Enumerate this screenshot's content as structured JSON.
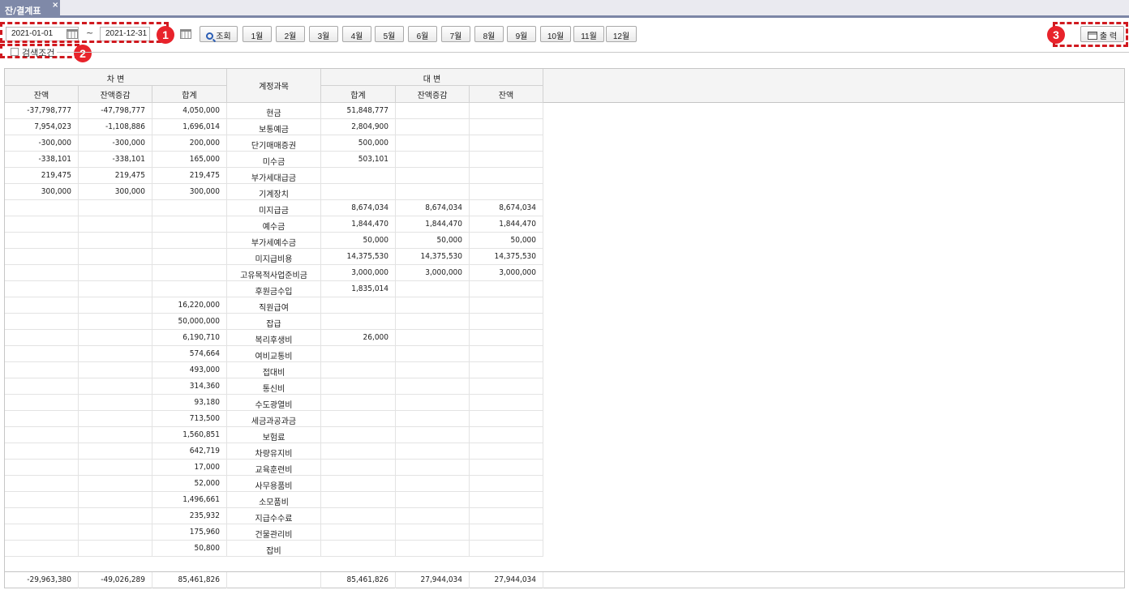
{
  "tab": {
    "title": "잔/결계표",
    "close": "×"
  },
  "toolbar": {
    "date_from": "2021-01-01",
    "tilde": "~",
    "date_to": "2021-12-31",
    "search_label": "조회",
    "months": [
      "1월",
      "2월",
      "3월",
      "4월",
      "5월",
      "6월",
      "7월",
      "8월",
      "9월",
      "10월",
      "11월",
      "12월"
    ],
    "print_label": "출 력"
  },
  "callouts": [
    "1",
    "2",
    "3"
  ],
  "search_conditions": {
    "label": "검색조건"
  },
  "header": {
    "debit_group": "차 변",
    "credit_group": "대 변",
    "account": "계정과목",
    "debit_cols": [
      "잔액",
      "잔액증감",
      "합계"
    ],
    "credit_cols": [
      "합계",
      "잔액증감",
      "잔액"
    ]
  },
  "rows": [
    {
      "d_bal": "-37,798,777",
      "d_chg": "-47,798,777",
      "d_sum": "4,050,000",
      "account": "현금",
      "c_sum": "51,848,777",
      "c_chg": "",
      "c_bal": ""
    },
    {
      "d_bal": "7,954,023",
      "d_chg": "-1,108,886",
      "d_sum": "1,696,014",
      "account": "보통예금",
      "c_sum": "2,804,900",
      "c_chg": "",
      "c_bal": ""
    },
    {
      "d_bal": "-300,000",
      "d_chg": "-300,000",
      "d_sum": "200,000",
      "account": "단기매매증권",
      "c_sum": "500,000",
      "c_chg": "",
      "c_bal": ""
    },
    {
      "d_bal": "-338,101",
      "d_chg": "-338,101",
      "d_sum": "165,000",
      "account": "미수금",
      "c_sum": "503,101",
      "c_chg": "",
      "c_bal": ""
    },
    {
      "d_bal": "219,475",
      "d_chg": "219,475",
      "d_sum": "219,475",
      "account": "부가세대급금",
      "c_sum": "",
      "c_chg": "",
      "c_bal": ""
    },
    {
      "d_bal": "300,000",
      "d_chg": "300,000",
      "d_sum": "300,000",
      "account": "기계장치",
      "c_sum": "",
      "c_chg": "",
      "c_bal": ""
    },
    {
      "d_bal": "",
      "d_chg": "",
      "d_sum": "",
      "account": "미지급금",
      "c_sum": "8,674,034",
      "c_chg": "8,674,034",
      "c_bal": "8,674,034"
    },
    {
      "d_bal": "",
      "d_chg": "",
      "d_sum": "",
      "account": "예수금",
      "c_sum": "1,844,470",
      "c_chg": "1,844,470",
      "c_bal": "1,844,470"
    },
    {
      "d_bal": "",
      "d_chg": "",
      "d_sum": "",
      "account": "부가세예수금",
      "c_sum": "50,000",
      "c_chg": "50,000",
      "c_bal": "50,000"
    },
    {
      "d_bal": "",
      "d_chg": "",
      "d_sum": "",
      "account": "미지급비용",
      "c_sum": "14,375,530",
      "c_chg": "14,375,530",
      "c_bal": "14,375,530"
    },
    {
      "d_bal": "",
      "d_chg": "",
      "d_sum": "",
      "account": "고유목적사업준비금",
      "c_sum": "3,000,000",
      "c_chg": "3,000,000",
      "c_bal": "3,000,000"
    },
    {
      "d_bal": "",
      "d_chg": "",
      "d_sum": "",
      "account": "후원금수입",
      "c_sum": "1,835,014",
      "c_chg": "",
      "c_bal": ""
    },
    {
      "d_bal": "",
      "d_chg": "",
      "d_sum": "16,220,000",
      "account": "직원급여",
      "c_sum": "",
      "c_chg": "",
      "c_bal": ""
    },
    {
      "d_bal": "",
      "d_chg": "",
      "d_sum": "50,000,000",
      "account": "잡급",
      "c_sum": "",
      "c_chg": "",
      "c_bal": ""
    },
    {
      "d_bal": "",
      "d_chg": "",
      "d_sum": "6,190,710",
      "account": "복리후생비",
      "c_sum": "26,000",
      "c_chg": "",
      "c_bal": ""
    },
    {
      "d_bal": "",
      "d_chg": "",
      "d_sum": "574,664",
      "account": "여비교통비",
      "c_sum": "",
      "c_chg": "",
      "c_bal": ""
    },
    {
      "d_bal": "",
      "d_chg": "",
      "d_sum": "493,000",
      "account": "접대비",
      "c_sum": "",
      "c_chg": "",
      "c_bal": ""
    },
    {
      "d_bal": "",
      "d_chg": "",
      "d_sum": "314,360",
      "account": "통신비",
      "c_sum": "",
      "c_chg": "",
      "c_bal": ""
    },
    {
      "d_bal": "",
      "d_chg": "",
      "d_sum": "93,180",
      "account": "수도광열비",
      "c_sum": "",
      "c_chg": "",
      "c_bal": ""
    },
    {
      "d_bal": "",
      "d_chg": "",
      "d_sum": "713,500",
      "account": "세금과공과금",
      "c_sum": "",
      "c_chg": "",
      "c_bal": ""
    },
    {
      "d_bal": "",
      "d_chg": "",
      "d_sum": "1,560,851",
      "account": "보험료",
      "c_sum": "",
      "c_chg": "",
      "c_bal": ""
    },
    {
      "d_bal": "",
      "d_chg": "",
      "d_sum": "642,719",
      "account": "차량유지비",
      "c_sum": "",
      "c_chg": "",
      "c_bal": ""
    },
    {
      "d_bal": "",
      "d_chg": "",
      "d_sum": "17,000",
      "account": "교육훈련비",
      "c_sum": "",
      "c_chg": "",
      "c_bal": ""
    },
    {
      "d_bal": "",
      "d_chg": "",
      "d_sum": "52,000",
      "account": "사무용품비",
      "c_sum": "",
      "c_chg": "",
      "c_bal": ""
    },
    {
      "d_bal": "",
      "d_chg": "",
      "d_sum": "1,496,661",
      "account": "소모품비",
      "c_sum": "",
      "c_chg": "",
      "c_bal": ""
    },
    {
      "d_bal": "",
      "d_chg": "",
      "d_sum": "235,932",
      "account": "지급수수료",
      "c_sum": "",
      "c_chg": "",
      "c_bal": ""
    },
    {
      "d_bal": "",
      "d_chg": "",
      "d_sum": "175,960",
      "account": "건물관리비",
      "c_sum": "",
      "c_chg": "",
      "c_bal": ""
    },
    {
      "d_bal": "",
      "d_chg": "",
      "d_sum": "50,800",
      "account": "잡비",
      "c_sum": "",
      "c_chg": "",
      "c_bal": ""
    }
  ],
  "totals": {
    "d_bal": "-29,963,380",
    "d_chg": "-49,026,289",
    "d_sum": "85,461,826",
    "account": "",
    "c_sum": "85,461,826",
    "c_chg": "27,944,034",
    "c_bal": "27,944,034"
  }
}
